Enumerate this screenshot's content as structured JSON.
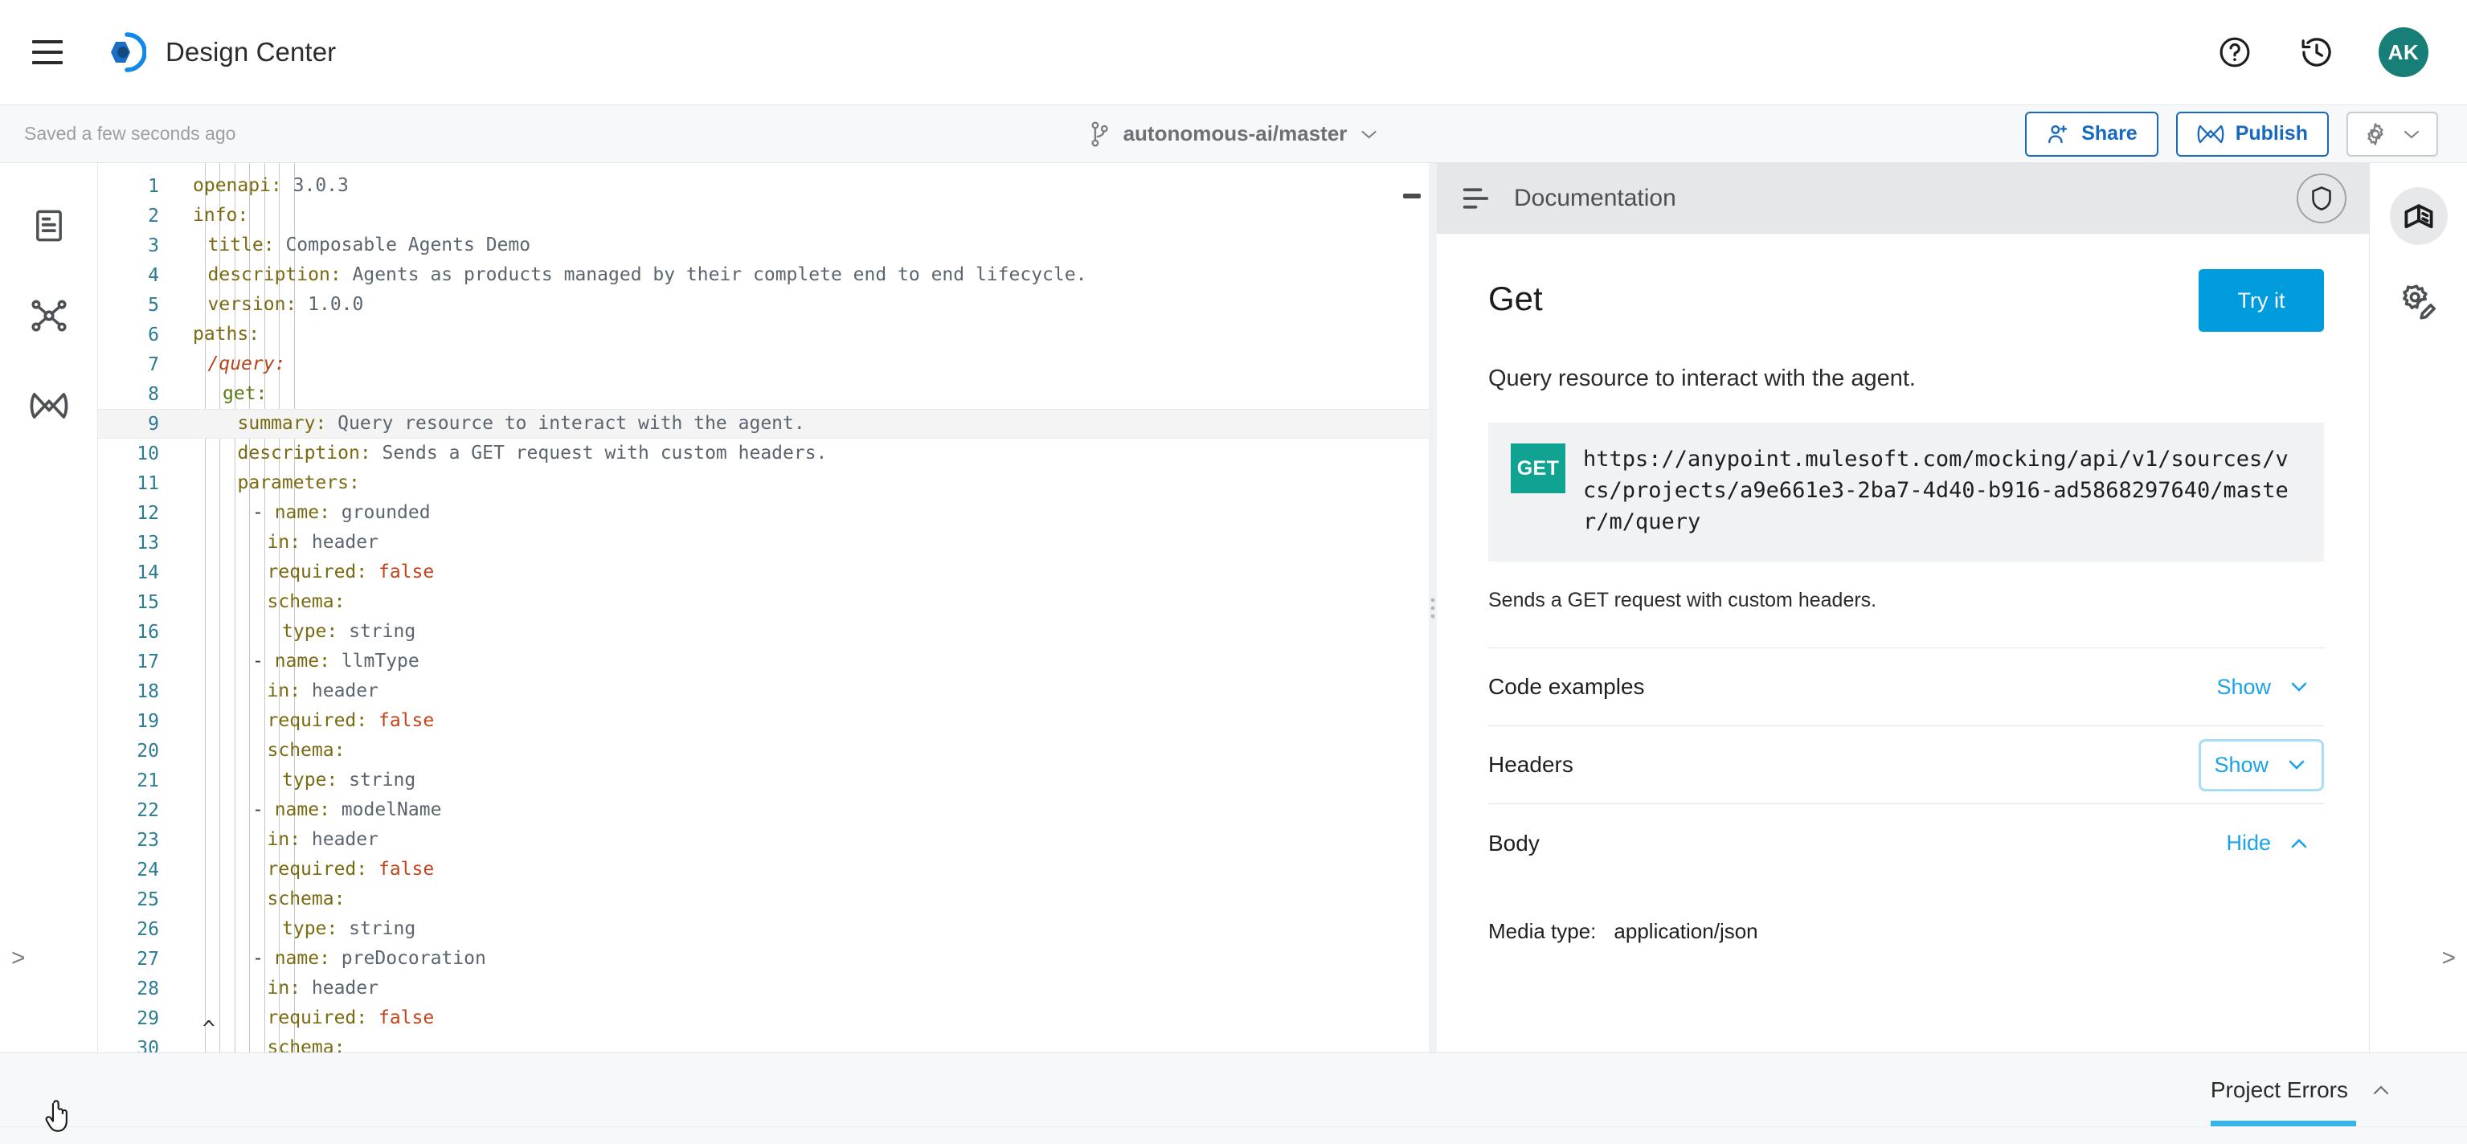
{
  "topbar": {
    "menu_icon": "hamburger-menu-icon",
    "logo_icon": "anypoint-logo-icon",
    "title": "Design Center",
    "help_icon": "help-circle-icon",
    "history_icon": "history-clock-icon",
    "avatar_initials": "AK"
  },
  "subbar": {
    "saved_status": "Saved a few seconds ago",
    "branch_icon": "git-branch-icon",
    "branch_name": "autonomous-ai/master",
    "branch_chevron": "chevron-down-icon",
    "share_label": "Share",
    "share_icon": "user-plus-icon",
    "publish_label": "Publish",
    "publish_icon": "mulesoft-infinity-icon",
    "settings_icon": "gear-icon",
    "settings_chevron": "chevron-down-icon"
  },
  "left_rail": {
    "items": [
      {
        "name": "sidebar-item-file",
        "icon": "document-file-icon"
      },
      {
        "name": "sidebar-item-dependencies",
        "icon": "network-graph-icon"
      },
      {
        "name": "sidebar-item-mulesoft",
        "icon": "mulesoft-infinity-icon"
      }
    ],
    "expand_chevron": ">"
  },
  "right_rail": {
    "items": [
      {
        "name": "sidebar-item-documentation",
        "icon": "open-book-icon",
        "active": true
      },
      {
        "name": "sidebar-item-mocking-config",
        "icon": "gear-pencil-icon",
        "active": false
      }
    ],
    "expand_chevron": ">"
  },
  "editor": {
    "collapse_chevron": "^",
    "lines": [
      {
        "n": "1",
        "indent": 0,
        "parts": [
          {
            "t": "openapi:",
            "c": "k"
          },
          {
            "t": " 3.0.3",
            "c": "v"
          }
        ]
      },
      {
        "n": "2",
        "indent": 0,
        "parts": [
          {
            "t": "info:",
            "c": "k"
          }
        ]
      },
      {
        "n": "3",
        "indent": 1,
        "parts": [
          {
            "t": "title:",
            "c": "k"
          },
          {
            "t": " Composable Agents Demo",
            "c": "v"
          }
        ]
      },
      {
        "n": "4",
        "indent": 1,
        "parts": [
          {
            "t": "description:",
            "c": "k"
          },
          {
            "t": " Agents as products managed by their complete end to end lifecycle.",
            "c": "v"
          }
        ]
      },
      {
        "n": "5",
        "indent": 1,
        "parts": [
          {
            "t": "version:",
            "c": "k"
          },
          {
            "t": " 1.0.0",
            "c": "v"
          }
        ]
      },
      {
        "n": "6",
        "indent": 0,
        "parts": [
          {
            "t": "paths:",
            "c": "k"
          }
        ]
      },
      {
        "n": "7",
        "indent": 1,
        "parts": [
          {
            "t": "/query:",
            "c": "kpath"
          }
        ]
      },
      {
        "n": "8",
        "indent": 2,
        "parts": [
          {
            "t": "get:",
            "c": "kmethod"
          }
        ]
      },
      {
        "n": "9",
        "indent": 3,
        "active": true,
        "parts": [
          {
            "t": "summary:",
            "c": "k"
          },
          {
            "t": " Query resource to interact with the agent.",
            "c": "v"
          }
        ]
      },
      {
        "n": "10",
        "indent": 3,
        "parts": [
          {
            "t": "description:",
            "c": "k"
          },
          {
            "t": " Sends a GET request with custom headers.",
            "c": "v"
          }
        ]
      },
      {
        "n": "11",
        "indent": 3,
        "parts": [
          {
            "t": "parameters:",
            "c": "k"
          }
        ]
      },
      {
        "n": "12",
        "indent": 4,
        "parts": [
          {
            "t": "- ",
            "c": "dash"
          },
          {
            "t": "name:",
            "c": "k"
          },
          {
            "t": " grounded",
            "c": "v"
          }
        ]
      },
      {
        "n": "13",
        "indent": 5,
        "parts": [
          {
            "t": "in:",
            "c": "k"
          },
          {
            "t": " header",
            "c": "v"
          }
        ]
      },
      {
        "n": "14",
        "indent": 5,
        "parts": [
          {
            "t": "required:",
            "c": "k"
          },
          {
            "t": " ",
            "c": "v"
          },
          {
            "t": "false",
            "c": "bool"
          }
        ]
      },
      {
        "n": "15",
        "indent": 5,
        "parts": [
          {
            "t": "schema:",
            "c": "k"
          }
        ]
      },
      {
        "n": "16",
        "indent": 6,
        "parts": [
          {
            "t": "type:",
            "c": "k"
          },
          {
            "t": " string",
            "c": "v"
          }
        ]
      },
      {
        "n": "17",
        "indent": 4,
        "parts": [
          {
            "t": "- ",
            "c": "dash"
          },
          {
            "t": "name:",
            "c": "k"
          },
          {
            "t": " llmType",
            "c": "v"
          }
        ]
      },
      {
        "n": "18",
        "indent": 5,
        "parts": [
          {
            "t": "in:",
            "c": "k"
          },
          {
            "t": " header",
            "c": "v"
          }
        ]
      },
      {
        "n": "19",
        "indent": 5,
        "parts": [
          {
            "t": "required:",
            "c": "k"
          },
          {
            "t": " ",
            "c": "v"
          },
          {
            "t": "false",
            "c": "bool"
          }
        ]
      },
      {
        "n": "20",
        "indent": 5,
        "parts": [
          {
            "t": "schema:",
            "c": "k"
          }
        ]
      },
      {
        "n": "21",
        "indent": 6,
        "parts": [
          {
            "t": "type:",
            "c": "k"
          },
          {
            "t": " string",
            "c": "v"
          }
        ]
      },
      {
        "n": "22",
        "indent": 4,
        "parts": [
          {
            "t": "- ",
            "c": "dash"
          },
          {
            "t": "name:",
            "c": "k"
          },
          {
            "t": " modelName",
            "c": "v"
          }
        ]
      },
      {
        "n": "23",
        "indent": 5,
        "parts": [
          {
            "t": "in:",
            "c": "k"
          },
          {
            "t": " header",
            "c": "v"
          }
        ]
      },
      {
        "n": "24",
        "indent": 5,
        "parts": [
          {
            "t": "required:",
            "c": "k"
          },
          {
            "t": " ",
            "c": "v"
          },
          {
            "t": "false",
            "c": "bool"
          }
        ]
      },
      {
        "n": "25",
        "indent": 5,
        "parts": [
          {
            "t": "schema:",
            "c": "k"
          }
        ]
      },
      {
        "n": "26",
        "indent": 6,
        "parts": [
          {
            "t": "type:",
            "c": "k"
          },
          {
            "t": " string",
            "c": "v"
          }
        ]
      },
      {
        "n": "27",
        "indent": 4,
        "parts": [
          {
            "t": "- ",
            "c": "dash"
          },
          {
            "t": "name:",
            "c": "k"
          },
          {
            "t": " preDocoration",
            "c": "v"
          }
        ]
      },
      {
        "n": "28",
        "indent": 5,
        "parts": [
          {
            "t": "in:",
            "c": "k"
          },
          {
            "t": " header",
            "c": "v"
          }
        ]
      },
      {
        "n": "29",
        "indent": 5,
        "parts": [
          {
            "t": "required:",
            "c": "k"
          },
          {
            "t": " ",
            "c": "v"
          },
          {
            "t": "false",
            "c": "bool"
          }
        ]
      },
      {
        "n": "30",
        "indent": 5,
        "parts": [
          {
            "t": "schema:",
            "c": "k"
          }
        ]
      }
    ]
  },
  "doc": {
    "panel_icon": "documentation-lines-icon",
    "panel_title": "Documentation",
    "shield_icon": "shield-icon",
    "operation_title": "Get",
    "try_it_label": "Try it",
    "summary": "Query resource to interact with the agent.",
    "method": "GET",
    "url": "https://anypoint.mulesoft.com/mocking/api/v1/sources/vcs/projects/a9e661e3-2ba7-4d40-b916-ad5868297640/master/m/query",
    "description": "Sends a GET request with custom headers.",
    "sections": [
      {
        "label": "Code examples",
        "toggle": "Show",
        "chevron": "down",
        "focused": false
      },
      {
        "label": "Headers",
        "toggle": "Show",
        "chevron": "down",
        "focused": true
      },
      {
        "label": "Body",
        "toggle": "Hide",
        "chevron": "up",
        "focused": false
      }
    ],
    "media_label": "Media type:",
    "media_value": "application/json"
  },
  "bottom": {
    "errors_tab_label": "Project Errors",
    "errors_chevron": "chevron-up-icon"
  },
  "colors": {
    "accent_blue": "#1668c1",
    "try_it_blue": "#009cdd",
    "link_blue": "#1aa3e8",
    "get_green": "#11a391",
    "avatar_teal": "#177f77",
    "tab_underline": "#35b4e8"
  }
}
